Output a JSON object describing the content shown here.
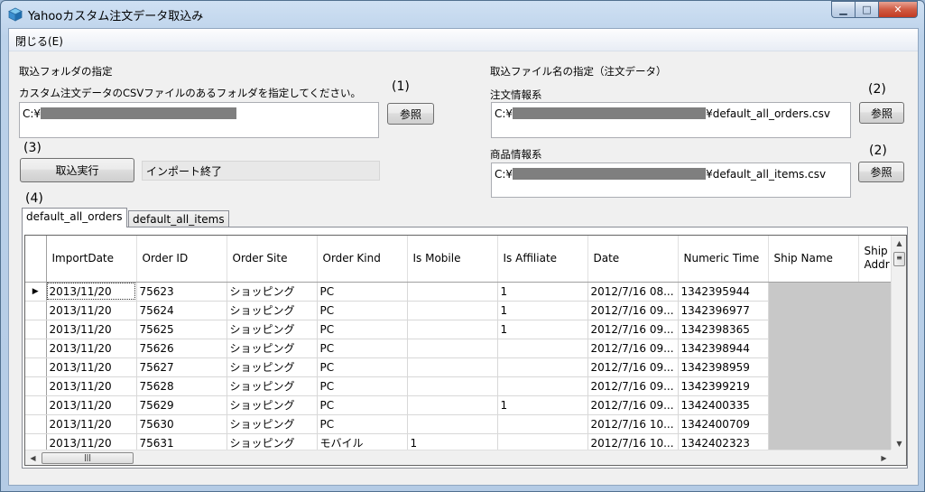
{
  "window": {
    "title": "Yahooカスタム注文データ取込み",
    "min_glyph": "▁",
    "max_glyph": "□",
    "close_glyph": "✕"
  },
  "menu": {
    "close": "閉じる(E)"
  },
  "left": {
    "folder_heading": "取込フォルダの指定",
    "folder_desc": "カスタム注文データのCSVファイルのあるフォルダを指定してください。",
    "num1": "(1)",
    "folder_path_prefix": "C:¥",
    "browse_label": "参照",
    "num3": "(3)",
    "run_label": "取込実行",
    "status": "インポート終了",
    "num4": "(4)"
  },
  "right": {
    "file_heading": "取込ファイル名の指定（注文データ）",
    "orders_label": "注文情報系",
    "orders_prefix": "C:¥",
    "orders_suffix": "¥default_all_orders.csv",
    "num2a": "(2)",
    "browse_label": "参照",
    "items_label": "商品情報系",
    "items_prefix": "C:¥",
    "items_suffix": "¥default_all_items.csv",
    "num2b": "(2)"
  },
  "tabs": [
    "default_all_orders",
    "default_all_items"
  ],
  "grid": {
    "columns": [
      "ImportDate",
      "Order ID",
      "Order Site",
      "Order Kind",
      "Is Mobile",
      "Is Affiliate",
      "Date",
      "Numeric Time",
      "Ship Name",
      "Ship Addr"
    ],
    "current_row_marker": "▶",
    "rows": [
      [
        "2013/11/20",
        "75623",
        "ショッピング",
        "PC",
        "",
        "1",
        "2012/7/16 08...",
        "1342395944"
      ],
      [
        "2013/11/20",
        "75624",
        "ショッピング",
        "PC",
        "",
        "1",
        "2012/7/16 09...",
        "1342396977"
      ],
      [
        "2013/11/20",
        "75625",
        "ショッピング",
        "PC",
        "",
        "1",
        "2012/7/16 09...",
        "1342398365"
      ],
      [
        "2013/11/20",
        "75626",
        "ショッピング",
        "PC",
        "",
        "",
        "2012/7/16 09...",
        "1342398944"
      ],
      [
        "2013/11/20",
        "75627",
        "ショッピング",
        "PC",
        "",
        "",
        "2012/7/16 09...",
        "1342398959"
      ],
      [
        "2013/11/20",
        "75628",
        "ショッピング",
        "PC",
        "",
        "",
        "2012/7/16 09...",
        "1342399219"
      ],
      [
        "2013/11/20",
        "75629",
        "ショッピング",
        "PC",
        "",
        "1",
        "2012/7/16 09...",
        "1342400335"
      ],
      [
        "2013/11/20",
        "75630",
        "ショッピング",
        "PC",
        "",
        "",
        "2012/7/16 10...",
        "1342400709"
      ],
      [
        "2013/11/20",
        "75631",
        "ショッピング",
        "モバイル",
        "1",
        "",
        "2012/7/16 10...",
        "1342402323"
      ]
    ],
    "scroll_up": "▲",
    "scroll_down": "▼",
    "scroll_left": "◀",
    "scroll_right": "▶",
    "thumb_grip_v": "≡",
    "thumb_grip_h": "|||"
  }
}
